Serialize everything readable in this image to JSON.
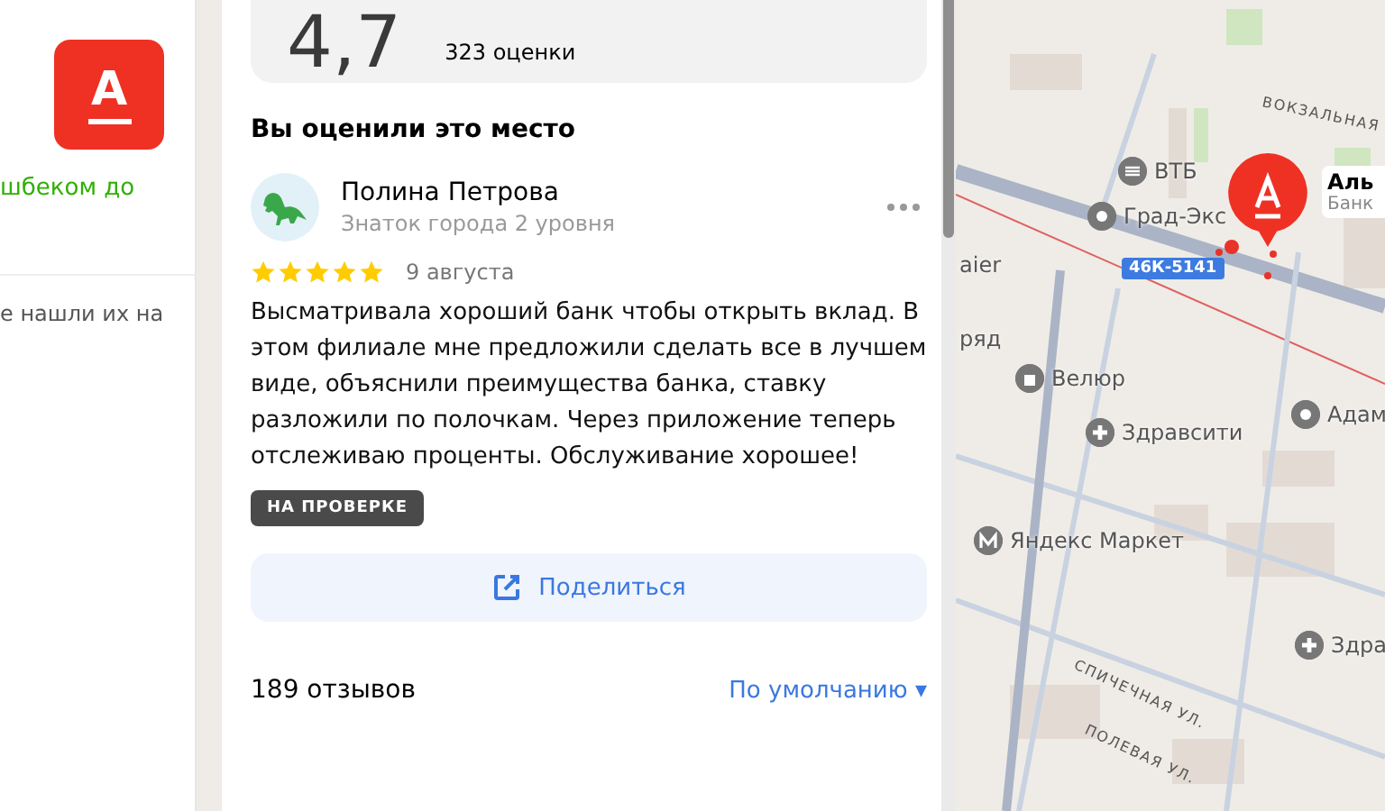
{
  "side_panel": {
    "logo_letter": "А",
    "promo_text": "шбеком до",
    "info_text": "е нашли их на"
  },
  "rating": {
    "score": "4,7",
    "count": "323 оценки"
  },
  "my_review": {
    "heading": "Вы оценили это место",
    "author": "Полина Петрова",
    "author_level": "Знаток города 2 уровня",
    "stars": 5,
    "date": "9 августа",
    "text": "Высматривала хороший банк чтобы открыть вклад. В этом филиале мне предложили сделать все в лучшем виде, объяснили преимущества банка, ставку разложили по полочкам. Через приложение теперь отслеживаю проценты. Обслуживание хорошее!",
    "status_badge": "НА ПРОВЕРКЕ",
    "share_button": "Поделиться"
  },
  "reviews_header": {
    "count": "189 отзывов",
    "sort": "По умолчанию",
    "sort_caret": "▾"
  },
  "map": {
    "pin": {
      "title": "Аль",
      "subtitle": "Банк"
    },
    "route_label": "46К-5141",
    "places": [
      {
        "name": "ВТБ",
        "kind": "bank"
      },
      {
        "name": "Град-Экс",
        "kind": "ring"
      },
      {
        "name": "Велюр",
        "kind": "bag"
      },
      {
        "name": "Здравсити",
        "kind": "plus"
      },
      {
        "name": "Адам",
        "kind": "ring"
      },
      {
        "name": "Яндекс Маркет",
        "kind": "market"
      },
      {
        "name": "Здра",
        "kind": "plus"
      },
      {
        "name": "aier",
        "kind": "none"
      },
      {
        "name": "ряд",
        "kind": "none"
      }
    ],
    "streets": [
      {
        "name": "ВОКЗАЛЬНАЯ"
      },
      {
        "name": "СПИЧЕЧНАЯ УЛ."
      },
      {
        "name": "ПОЛЕВАЯ УЛ."
      }
    ]
  }
}
